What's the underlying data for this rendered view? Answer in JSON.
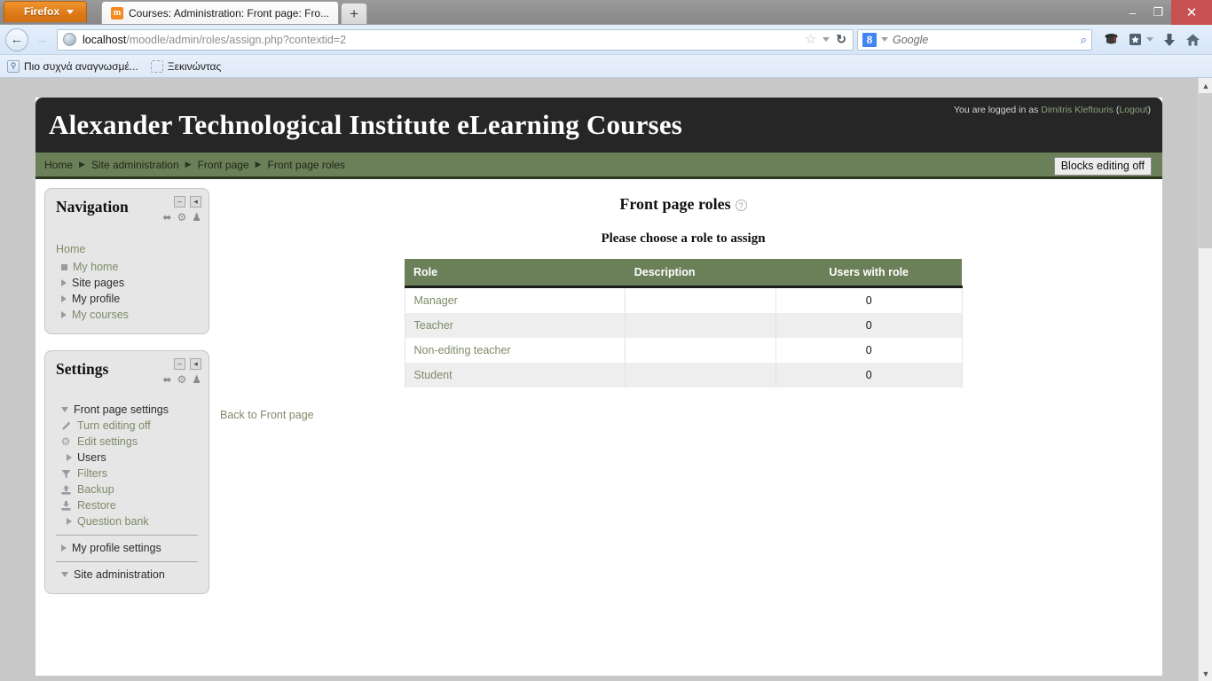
{
  "browser": {
    "firefox_button": "Firefox",
    "tab_title": "Courses: Administration: Front page: Fro...",
    "new_tab_label": "+",
    "window_minimize": "–",
    "window_restore": "❐",
    "window_close": "✕",
    "back_arrow": "←",
    "forward_arrow": "→",
    "url_host": "localhost",
    "url_path": "/moodle/admin/roles/assign.php?contextid=2",
    "star_glyph": "☆",
    "reload_glyph": "↻",
    "search_engine": "Google",
    "search_engine_badge": "8",
    "search_placeholder": "Google",
    "magnifier_glyph": "⌕",
    "toolbar_icons": [
      "graduation-cap-icon",
      "bookmarks-star-icon",
      "downloads-arrow-icon",
      "home-icon"
    ],
    "bookmarks": [
      {
        "label": "Πιο συχνά αναγνωσμέ...",
        "icon": "most-visited-icon"
      },
      {
        "label": "Ξεκινώντας",
        "icon": "getting-started-icon"
      }
    ]
  },
  "header": {
    "site_name": "Alexander Technological Institute eLearning Courses",
    "logged_in_prefix": "You are logged in as",
    "user_name": "Dimitris Kleftouris",
    "logout_open": "(",
    "logout_label": "Logout",
    "logout_close": ")"
  },
  "navbar": {
    "crumbs": [
      "Home",
      "Site administration",
      "Front page",
      "Front page roles"
    ],
    "separator": "▶",
    "blocks_editing_button": "Blocks editing off"
  },
  "blocks": {
    "navigation": {
      "title": "Navigation",
      "controls": [
        "minimize-icon",
        "dock-icon",
        "move-icon",
        "gear-icon",
        "assign-roles-icon"
      ],
      "minimize_glyph": "–",
      "dock_glyph": "◂",
      "move_glyph": "⬌",
      "gear_glyph": "⚙",
      "roles_glyph": "♟",
      "root_label": "Home",
      "items": [
        {
          "label": "My home",
          "marker": "square",
          "dim": true
        },
        {
          "label": "Site pages",
          "marker": "triangle",
          "dim": false
        },
        {
          "label": "My profile",
          "marker": "triangle",
          "dim": false
        },
        {
          "label": "My courses",
          "marker": "triangle",
          "dim": true
        }
      ]
    },
    "settings": {
      "title": "Settings",
      "minimize_glyph": "–",
      "dock_glyph": "◂",
      "move_glyph": "⬌",
      "gear_glyph": "⚙",
      "roles_glyph": "♟",
      "group_label": "Front page settings",
      "items": [
        {
          "label": "Turn editing off",
          "icon": "pencil-icon",
          "glyph": "✎"
        },
        {
          "label": "Edit settings",
          "icon": "gear-icon",
          "glyph": "⚙"
        },
        {
          "label": "Users",
          "icon": "expand-triangle-icon",
          "glyph": "",
          "dark": true
        },
        {
          "label": "Filters",
          "icon": "funnel-icon",
          "glyph": "▼"
        },
        {
          "label": "Backup",
          "icon": "backup-upload-icon",
          "glyph": "⬆"
        },
        {
          "label": "Restore",
          "icon": "restore-download-icon",
          "glyph": "⬇"
        },
        {
          "label": "Question bank",
          "icon": "expand-triangle-icon",
          "glyph": ""
        }
      ],
      "my_profile_settings": "My profile settings",
      "site_administration": "Site administration"
    }
  },
  "main": {
    "page_title": "Front page roles",
    "help_glyph": "?",
    "subtitle": "Please choose a role to assign",
    "table": {
      "columns": [
        "Role",
        "Description",
        "Users with role"
      ],
      "rows": [
        {
          "role": "Manager",
          "description": "",
          "users": "0"
        },
        {
          "role": "Teacher",
          "description": "",
          "users": "0"
        },
        {
          "role": "Non-editing teacher",
          "description": "",
          "users": "0"
        },
        {
          "role": "Student",
          "description": "",
          "users": "0"
        }
      ]
    },
    "back_link": "Back to Front page"
  },
  "scrollbar": {
    "up_glyph": "▲",
    "down_glyph": "▼"
  },
  "colors": {
    "header_bg": "#262626",
    "navbar_green": "#6b8058",
    "link_olive": "#7e8b68",
    "block_bg": "#e6e6e6",
    "row_alt": "#eeeeee"
  }
}
